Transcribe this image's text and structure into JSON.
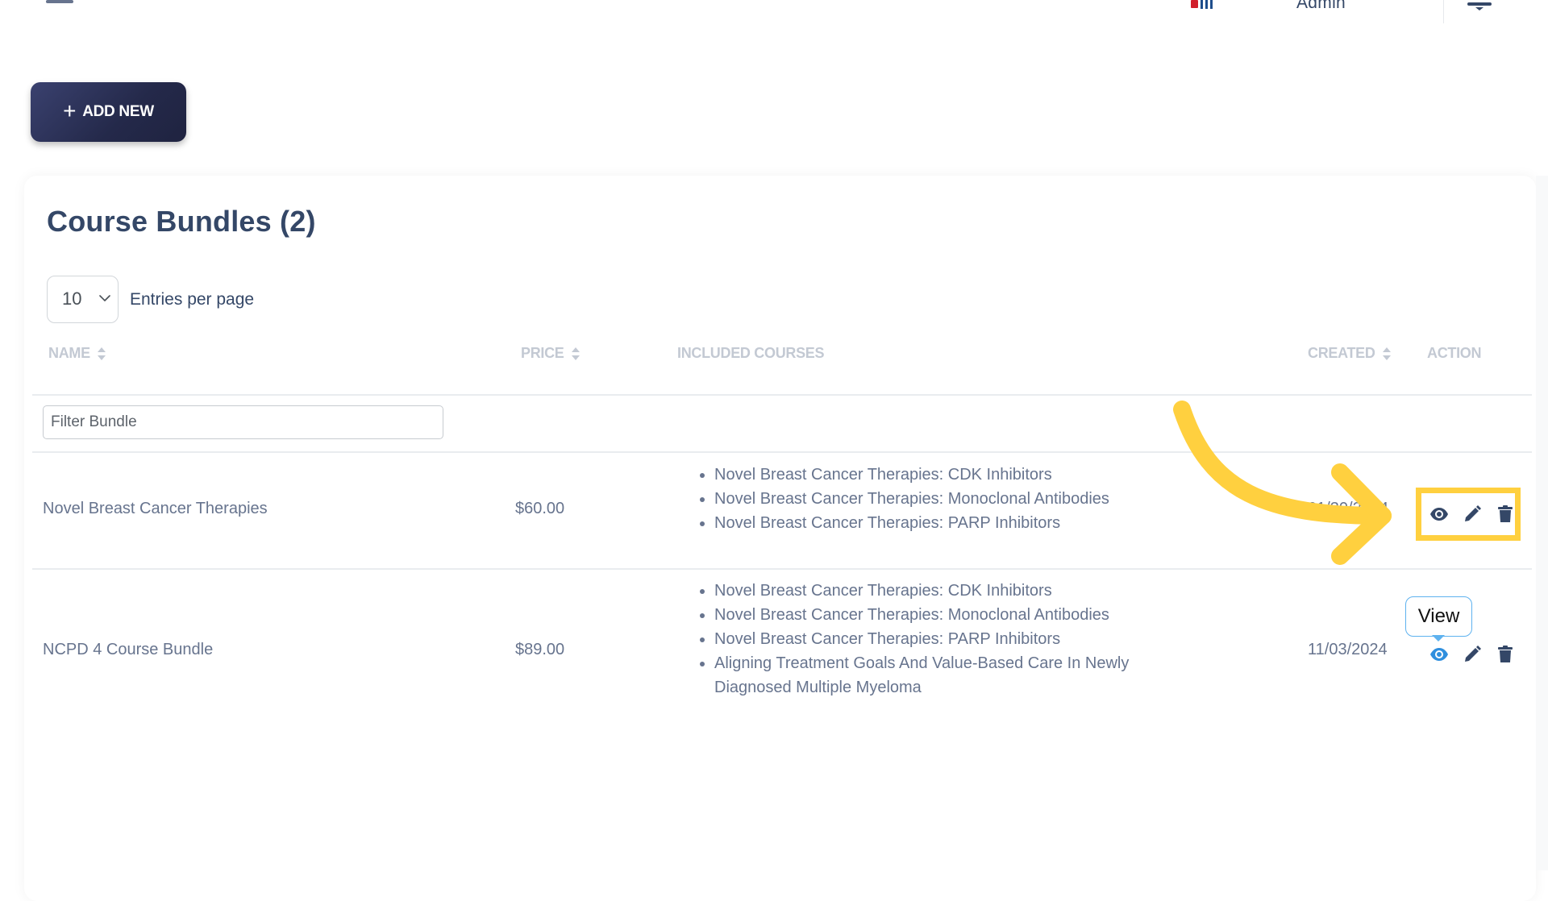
{
  "topbar": {
    "menu_icon": "hamburger-menu-icon",
    "logo_icon": "brand-logo-icon",
    "user_label": "Admin",
    "notification_icon": "bell-icon"
  },
  "toolbar": {
    "add_new_label": "ADD NEW",
    "add_new_icon": "+"
  },
  "card": {
    "title": "Course Bundles (2)",
    "entries_per_page": {
      "selected": "10",
      "label": "Entries per page"
    },
    "filter": {
      "placeholder": "Filter Bundle",
      "value": ""
    },
    "columns": [
      {
        "label": "NAME",
        "sortable": true
      },
      {
        "label": "PRICE",
        "sortable": true
      },
      {
        "label": "INCLUDED COURSES",
        "sortable": false
      },
      {
        "label": "CREATED",
        "sortable": true
      },
      {
        "label": "ACTION",
        "sortable": false
      }
    ],
    "rows": [
      {
        "name": "Novel Breast Cancer Therapies",
        "price": "$60.00",
        "courses": [
          "Novel Breast Cancer Therapies: CDK Inhibitors",
          "Novel Breast Cancer Therapies: Monoclonal Antibodies",
          "Novel Breast Cancer Therapies: PARP Inhibitors"
        ],
        "created": "01/30/2024",
        "actions": [
          "view",
          "edit",
          "delete"
        ]
      },
      {
        "name": "NCPD 4 Course Bundle",
        "price": "$89.00",
        "courses": [
          "Novel Breast Cancer Therapies: CDK Inhibitors",
          "Novel Breast Cancer Therapies: Monoclonal Antibodies",
          "Novel Breast Cancer Therapies: PARP Inhibitors",
          "Aligning Treatment Goals And Value-Based Care In Newly Diagnosed Multiple Myeloma"
        ],
        "created": "11/03/2024",
        "actions": [
          "view",
          "edit",
          "delete"
        ]
      }
    ],
    "tooltip": "View"
  },
  "colors": {
    "primary_dark": "#3a416f",
    "text": "#344767",
    "muted_text": "#67748e",
    "header_text": "#c3c9d3",
    "highlight_annotation": "#ffd03f",
    "tooltip_border": "#5eb2ef",
    "view_active": "#2f8fde"
  }
}
